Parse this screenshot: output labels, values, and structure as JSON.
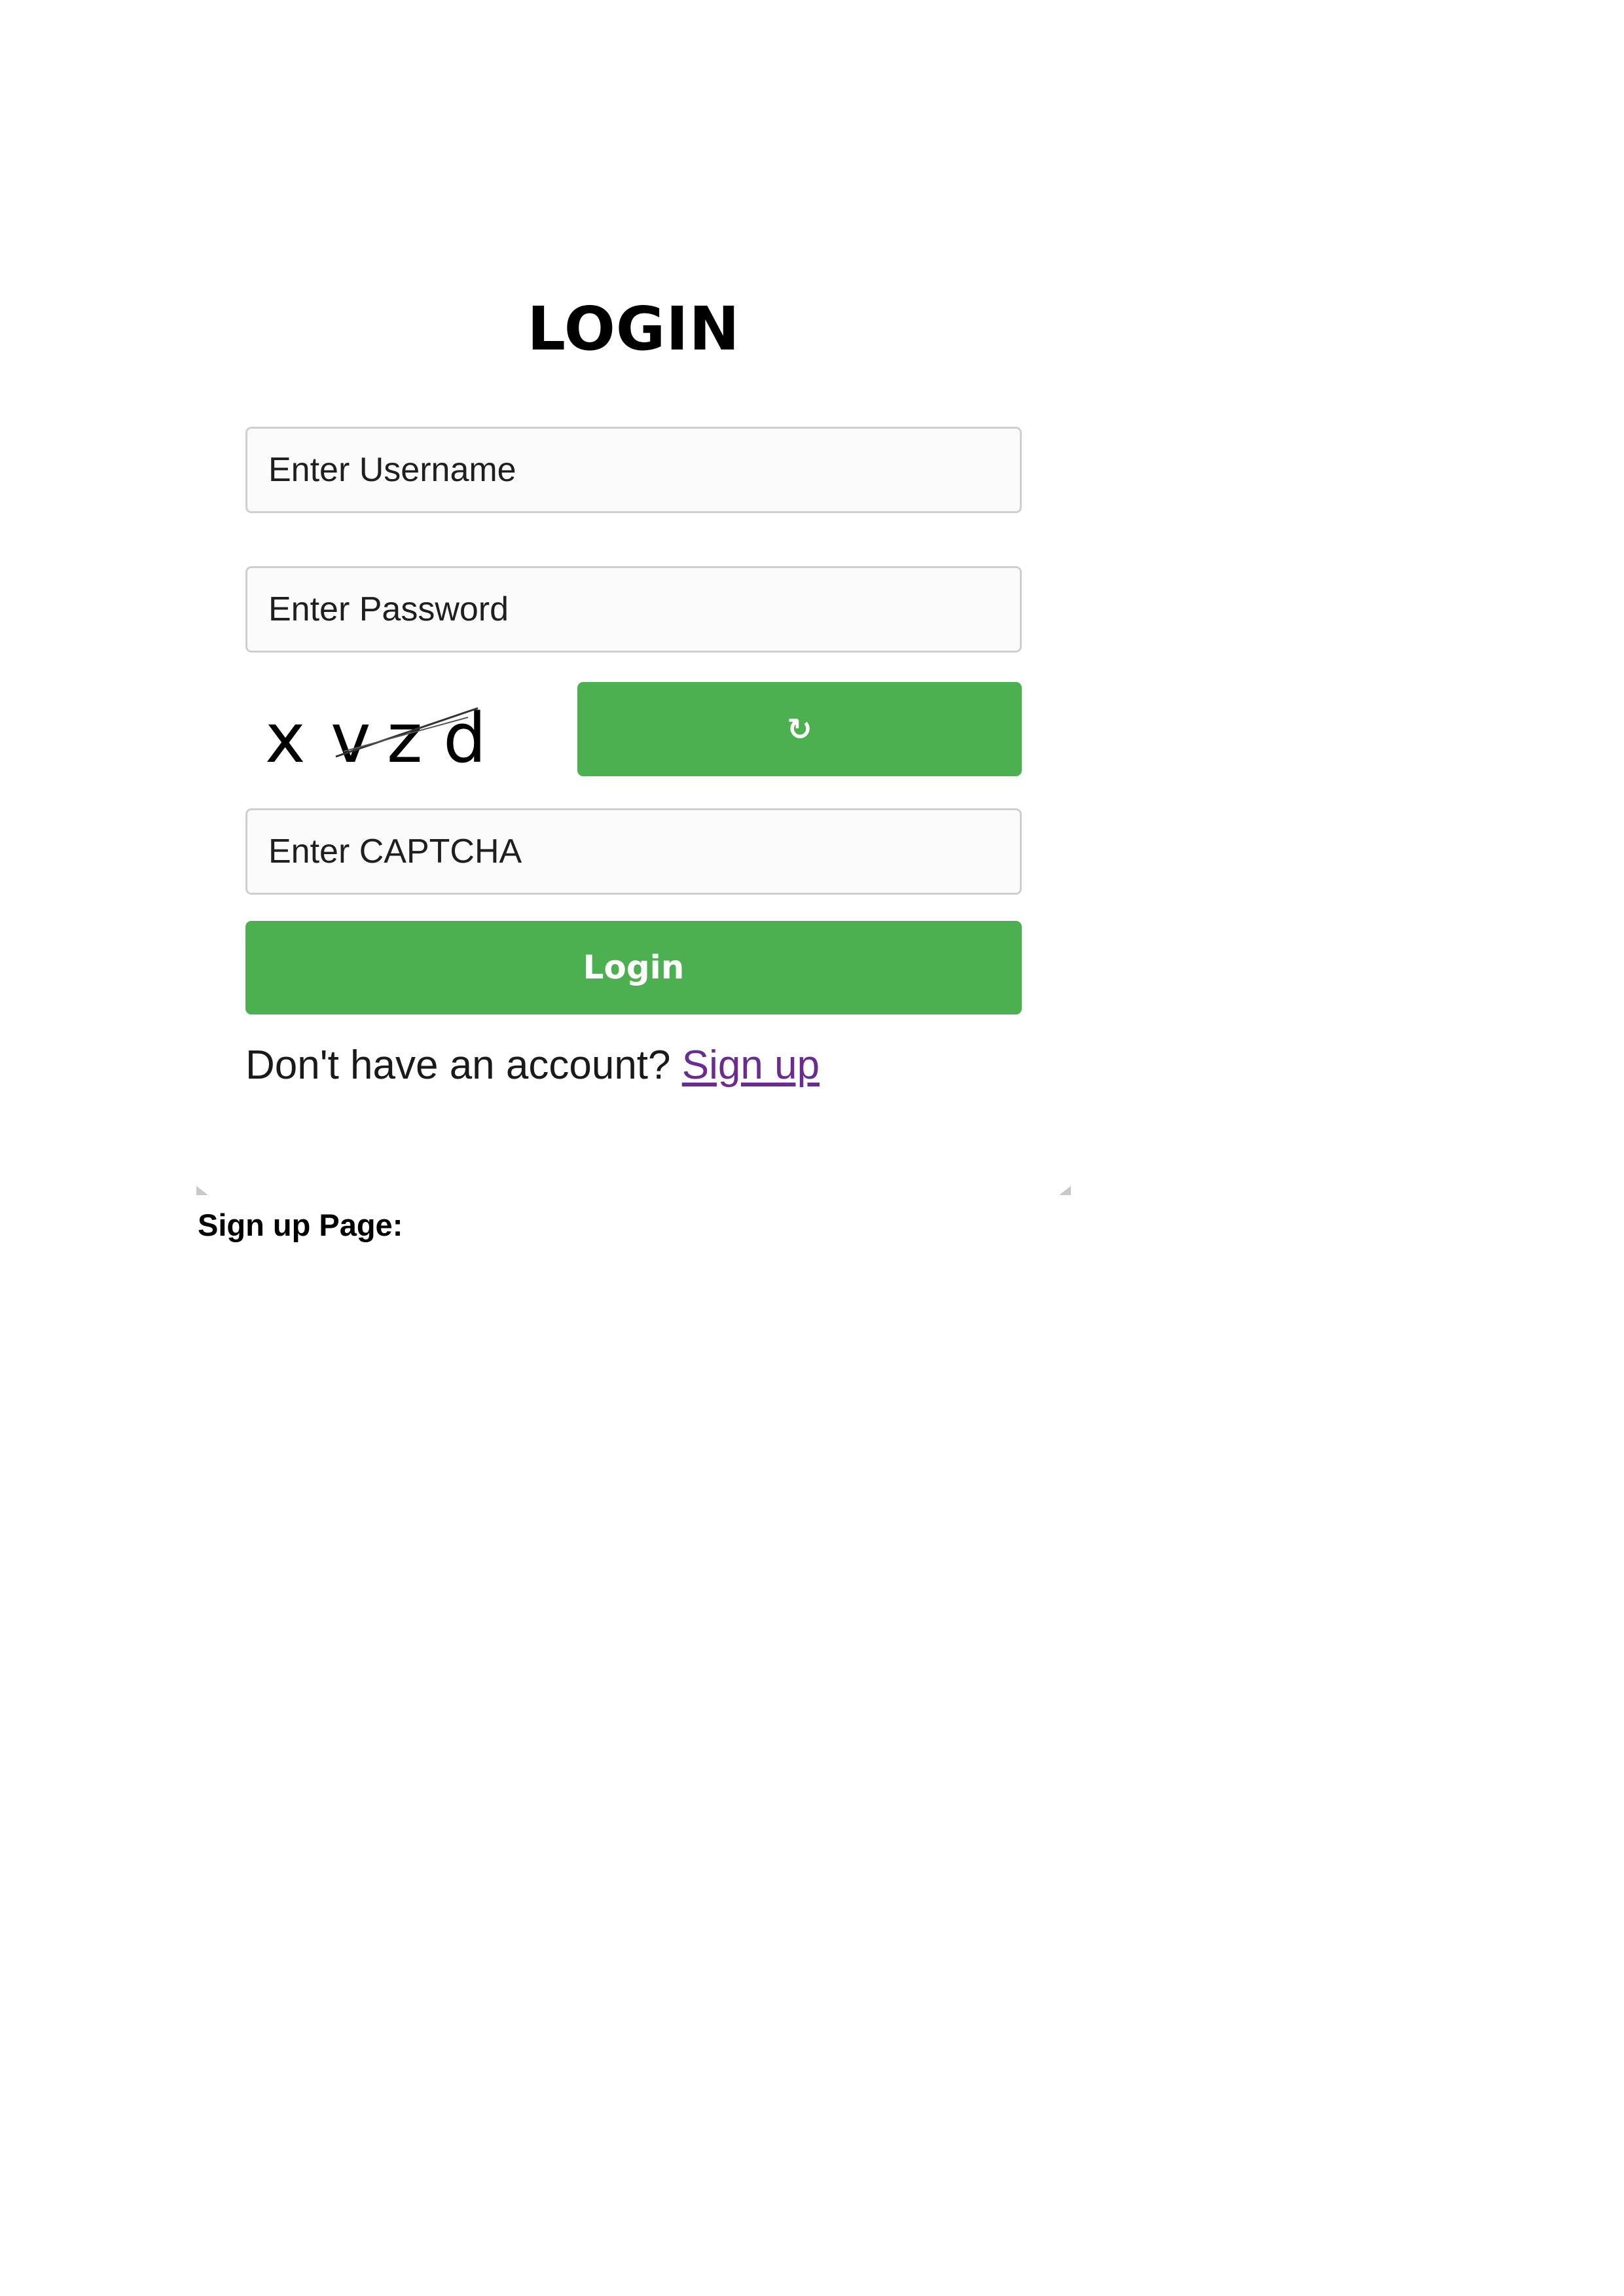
{
  "login_form": {
    "title": "LOGIN",
    "username_placeholder": "Enter Username",
    "password_placeholder": "Enter Password",
    "captcha_text": "x v z d",
    "captcha_chars": [
      "x",
      "v",
      "z",
      "d"
    ],
    "refresh_icon": "↻",
    "captcha_placeholder": "Enter CAPTCHA",
    "login_button_label": "Login",
    "signup_prompt_text": "Don't have an account?",
    "signup_link_text": "Sign up"
  },
  "document": {
    "section_caption": "Sign up Page:"
  },
  "colors": {
    "accent_green": "#4caf50",
    "link_purple": "#6a2c91",
    "field_border": "#cfcfcf",
    "field_background": "#fbfbfb"
  },
  "icons": {
    "refresh": "refresh-icon"
  }
}
